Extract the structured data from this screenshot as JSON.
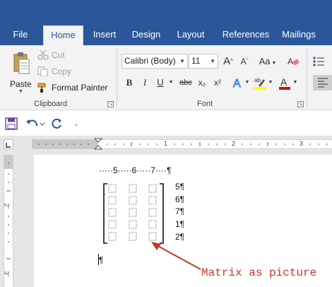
{
  "tabs": [
    {
      "label": "File",
      "active": false
    },
    {
      "label": "Home",
      "active": true
    },
    {
      "label": "Insert",
      "active": false
    },
    {
      "label": "Design",
      "active": false
    },
    {
      "label": "Layout",
      "active": false
    },
    {
      "label": "References",
      "active": false
    },
    {
      "label": "Mailings",
      "active": false
    }
  ],
  "clipboard": {
    "paste": "Paste",
    "cut": "Cut",
    "copy": "Copy",
    "format_painter": "Format Painter",
    "group_label": "Clipboard"
  },
  "font": {
    "font_name": "Calibri (Body)",
    "font_size": "11",
    "grow": "A",
    "shrink": "A",
    "case": "Aa",
    "bold": "B",
    "italic": "I",
    "underline": "U",
    "strike": "abc",
    "subscript": "x₂",
    "superscript": "x²",
    "group_label": "Font"
  },
  "ruler": {
    "h_numbers": [
      "1",
      "2",
      "3"
    ],
    "v_numbers": [
      "2",
      "3"
    ]
  },
  "document": {
    "tab_line": "·····5·····6·····7····¶",
    "row_labels": [
      "5¶",
      "6¶",
      "7¶",
      "1¶",
      "2¶"
    ],
    "empty_para": "¶",
    "annotation": "Matrix as picture"
  },
  "colors": {
    "ribbon_blue": "#2b579a",
    "annotation_red": "#c0392b",
    "highlight_yellow": "#ffff00",
    "font_color_red": "#e00000"
  }
}
